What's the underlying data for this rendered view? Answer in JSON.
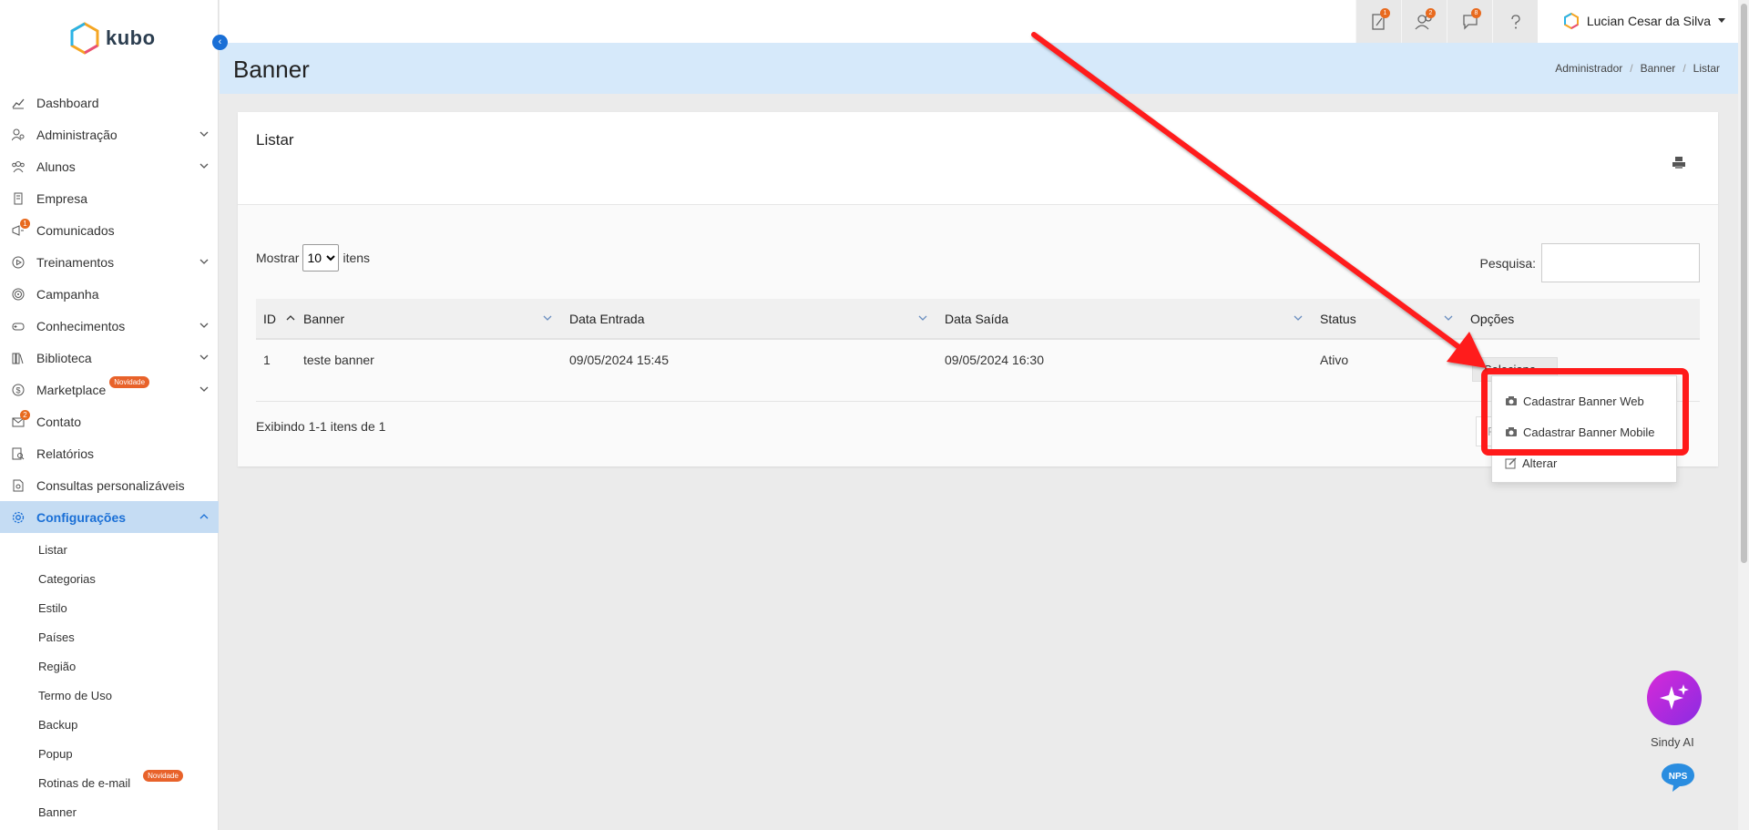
{
  "brand": {
    "name": "kubo"
  },
  "sidebar": {
    "items": [
      {
        "label": "Dashboard",
        "icon": "chart-line-icon",
        "chevron": false
      },
      {
        "label": "Administração",
        "icon": "user-cog-icon",
        "chevron": true
      },
      {
        "label": "Alunos",
        "icon": "users-icon",
        "chevron": true
      },
      {
        "label": "Empresa",
        "icon": "building-icon",
        "chevron": false
      },
      {
        "label": "Comunicados",
        "icon": "megaphone-icon",
        "chevron": false,
        "count": "1"
      },
      {
        "label": "Treinamentos",
        "icon": "play-circle-icon",
        "chevron": true
      },
      {
        "label": "Campanha",
        "icon": "target-icon",
        "chevron": false
      },
      {
        "label": "Conhecimentos",
        "icon": "gamepad-icon",
        "chevron": true
      },
      {
        "label": "Biblioteca",
        "icon": "books-icon",
        "chevron": true
      },
      {
        "label": "Marketplace",
        "icon": "dollar-circle-icon",
        "chevron": true,
        "badge": "Novidade"
      },
      {
        "label": "Contato",
        "icon": "mail-icon",
        "chevron": false,
        "count": "2"
      },
      {
        "label": "Relatórios",
        "icon": "report-search-icon",
        "chevron": false
      },
      {
        "label": "Consultas personalizáveis",
        "icon": "file-search-icon",
        "chevron": false
      },
      {
        "label": "Configurações",
        "icon": "gear-icon",
        "chevron": true,
        "active": true
      }
    ],
    "subitems": [
      {
        "label": "Listar"
      },
      {
        "label": "Categorias"
      },
      {
        "label": "Estilo"
      },
      {
        "label": "Países"
      },
      {
        "label": "Região"
      },
      {
        "label": "Termo de Uso"
      },
      {
        "label": "Backup"
      },
      {
        "label": "Popup"
      },
      {
        "label": "Rotinas de e-mail",
        "badge": "Novidade"
      },
      {
        "label": "Banner"
      }
    ]
  },
  "topbar": {
    "icons": [
      {
        "name": "pen-note-icon",
        "count": "1"
      },
      {
        "name": "users-icon",
        "count": "2"
      },
      {
        "name": "chat-icon",
        "count": "8"
      },
      {
        "name": "help-icon",
        "count": ""
      }
    ],
    "user_name": "Lucian Cesar da Silva"
  },
  "page": {
    "title": "Banner",
    "breadcrumb": [
      "Administrador",
      "Banner",
      "Listar"
    ]
  },
  "card": {
    "title": "Listar",
    "show_label": "Mostrar",
    "show_value": "10",
    "items_label": "itens",
    "search_label": "Pesquisa:",
    "search_value": "",
    "columns": [
      "ID",
      "Banner",
      "Data Entrada",
      "Data Saída",
      "Status",
      "Opções"
    ],
    "rows": [
      {
        "id": "1",
        "banner": "teste banner",
        "entrada": "09/05/2024 15:45",
        "saida": "09/05/2024 16:30",
        "status": "Ativo",
        "opcoes": "Selecione"
      }
    ],
    "footer_info": "Exibindo 1-1 itens de 1",
    "pager_first": "Primeiro"
  },
  "dropdown": {
    "items": [
      {
        "label": "Cadastrar Banner Web",
        "icon": "camera-icon"
      },
      {
        "label": "Cadastrar Banner Mobile",
        "icon": "camera-icon"
      },
      {
        "label": "Alterar",
        "icon": "edit-icon"
      }
    ]
  },
  "floating": {
    "sindy_label": "Sindy AI",
    "nps_label": "NPS"
  },
  "colors": {
    "accent": "#1a6fd6",
    "header_band": "#d6e9fa",
    "badge": "#e8622a",
    "annotation": "#ff1a1a"
  }
}
